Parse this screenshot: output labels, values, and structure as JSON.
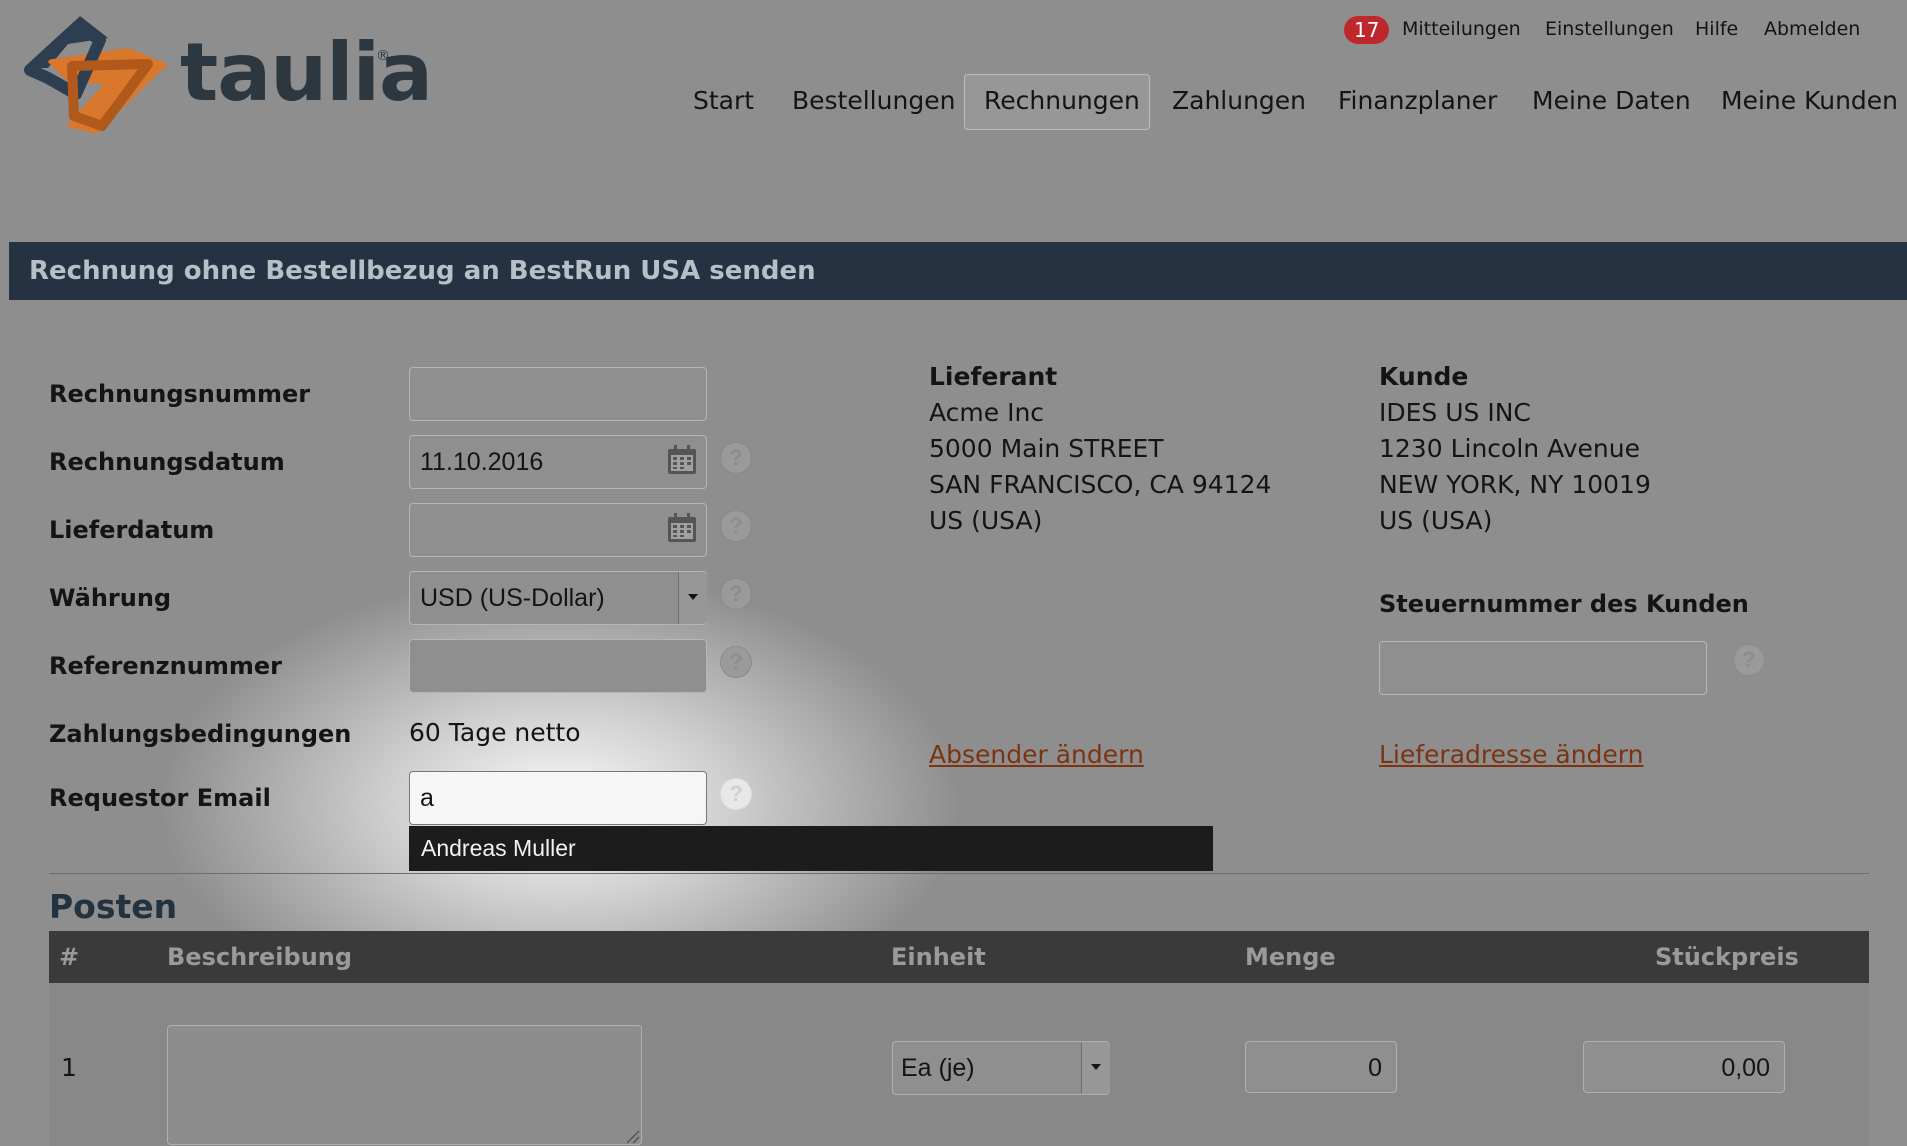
{
  "brand": {
    "name": "taulia",
    "reg": "®"
  },
  "util": {
    "badge_count": "17",
    "messages": "Mitteilungen",
    "settings": "Einstellungen",
    "help": "Hilfe",
    "logout": "Abmelden"
  },
  "nav": {
    "items": [
      "Start",
      "Bestellungen",
      "Rechnungen",
      "Zahlungen",
      "Finanzplaner",
      "Meine Daten",
      "Meine Kunden"
    ],
    "active": "Rechnungen"
  },
  "header": {
    "title": "Rechnung ohne Bestellbezug an BestRun USA senden"
  },
  "form": {
    "invoice_number_label": "Rechnungsnummer",
    "invoice_number_value": "",
    "invoice_date_label": "Rechnungsdatum",
    "invoice_date_value": "11.10.2016",
    "delivery_date_label": "Lieferdatum",
    "delivery_date_value": "",
    "currency_label": "Währung",
    "currency_value": "USD (US-Dollar)",
    "reference_label": "Referenznummer",
    "reference_value": "",
    "payment_terms_label": "Zahlungsbedingungen",
    "payment_terms_value": "60 Tage netto",
    "requestor_label": "Requestor Email",
    "requestor_value": "a",
    "help_glyph": "?"
  },
  "autocomplete": {
    "suggestion": "Andreas Muller"
  },
  "supplier": {
    "heading": "Lieferant",
    "lines": [
      "Acme Inc",
      "5000 Main STREET",
      "SAN FRANCISCO, CA 94124",
      "US (USA)"
    ],
    "change_link": "Absender ändern"
  },
  "customer": {
    "heading": "Kunde",
    "lines": [
      "IDES US INC",
      "1230 Lincoln Avenue",
      "NEW YORK, NY 10019",
      "US (USA)"
    ],
    "tax_label": "Steuernummer des Kunden",
    "tax_value": "",
    "change_link": "Lieferadresse ändern"
  },
  "items": {
    "section_title": "Posten",
    "columns": [
      "#",
      "Beschreibung",
      "Einheit",
      "Menge",
      "Stückpreis"
    ],
    "rows": [
      {
        "index": "1",
        "description": "",
        "unit": "Ea (je)",
        "quantity": "0",
        "price": "0,00"
      }
    ]
  },
  "colors": {
    "header_bar": "#243241",
    "badge": "#c0272d",
    "link": "#7a3413",
    "logo_orange": "#d9782d",
    "logo_navy": "#2c3e50"
  }
}
